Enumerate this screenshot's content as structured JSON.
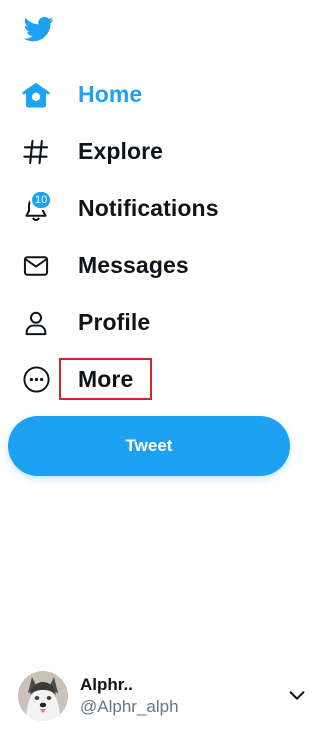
{
  "logo": {
    "icon": "twitter-bird-icon",
    "color": "#1da1f2"
  },
  "nav": {
    "items": [
      {
        "label": "Home",
        "icon": "home-icon",
        "active": true
      },
      {
        "label": "Explore",
        "icon": "hashtag-icon"
      },
      {
        "label": "Notifications",
        "icon": "bell-icon",
        "badge": "10"
      },
      {
        "label": "Messages",
        "icon": "envelope-icon"
      },
      {
        "label": "Profile",
        "icon": "person-icon"
      },
      {
        "label": "More",
        "icon": "more-circle-icon",
        "highlighted": true
      }
    ]
  },
  "tweet_button": {
    "label": "Tweet"
  },
  "account": {
    "name": "Alphr..",
    "handle": "@Alphr_alph",
    "avatar": "husky-dog-avatar"
  },
  "colors": {
    "accent": "#1da1f2",
    "text": "#0f1419",
    "muted": "#657786",
    "highlight": "#d0262b"
  }
}
